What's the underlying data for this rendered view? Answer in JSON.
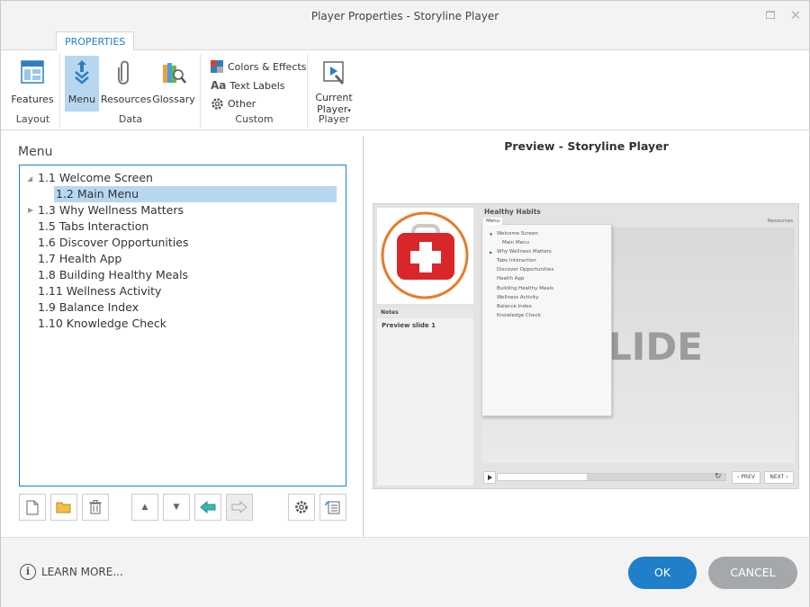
{
  "window": {
    "title": "Player Properties - Storyline Player"
  },
  "ribbon": {
    "tab": "PROPERTIES",
    "groups": {
      "layout": {
        "label": "Layout",
        "features": "Features"
      },
      "data": {
        "label": "Data",
        "menu": "Menu",
        "resources": "Resources",
        "glossary": "Glossary"
      },
      "custom": {
        "label": "Custom",
        "colors": "Colors & Effects",
        "text_labels": "Text Labels",
        "other": "Other"
      },
      "player": {
        "label": "Player",
        "current_player_line1": "Current",
        "current_player_line2": "Player"
      }
    }
  },
  "menu_panel": {
    "title": "Menu",
    "items": [
      {
        "label": "1.1 Welcome Screen"
      },
      {
        "label": "1.2 Main Menu"
      },
      {
        "label": "1.3 Why Wellness Matters"
      },
      {
        "label": "1.5 Tabs Interaction"
      },
      {
        "label": "1.6 Discover Opportunities"
      },
      {
        "label": "1.7 Health App"
      },
      {
        "label": "1.8 Building Healthy Meals"
      },
      {
        "label": "1.11 Wellness Activity"
      },
      {
        "label": "1.9 Balance Index"
      },
      {
        "label": "1.10 Knowledge Check"
      }
    ]
  },
  "preview": {
    "title": "Preview - Storyline Player",
    "heading": "Healthy Habits",
    "menu_tab": "Menu",
    "resources": "Resources",
    "notes_tab": "Notes",
    "notes_text": "Preview slide 1",
    "slide_word": "LIDE",
    "dropdown_items": [
      {
        "label": "Welcome Screen"
      },
      {
        "label": "Main Menu"
      },
      {
        "label": "Why Wellness Matters"
      },
      {
        "label": "Tabs Interaction"
      },
      {
        "label": "Discover Opportunities"
      },
      {
        "label": "Health App"
      },
      {
        "label": "Building Healthy Meals"
      },
      {
        "label": "Wellness Activity"
      },
      {
        "label": "Balance Index"
      },
      {
        "label": "Knowledge Check"
      }
    ],
    "prev": "‹ PREV",
    "next": "NEXT ›"
  },
  "footer": {
    "learn_more": "LEARN MORE...",
    "ok": "OK",
    "cancel": "CANCEL"
  },
  "colors": {
    "accent": "#1f7fc8",
    "selection": "#b7d7f0",
    "cancel": "#a5a8ab"
  }
}
